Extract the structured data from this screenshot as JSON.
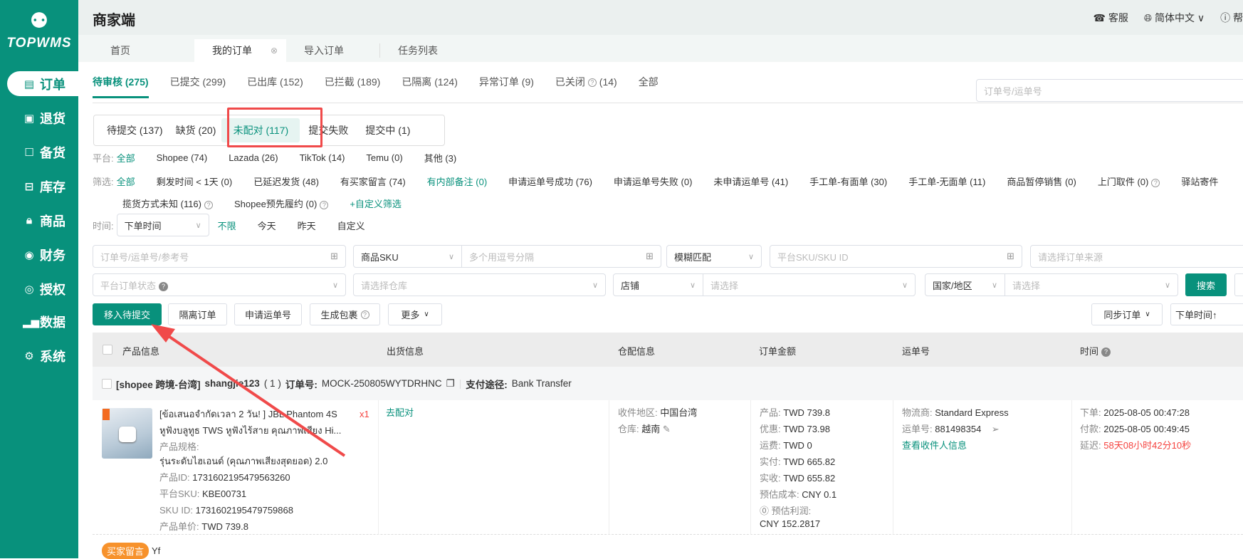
{
  "brand": {
    "name": "TOPWMS"
  },
  "sidebar": {
    "items": [
      {
        "label": "订单",
        "icon": "clipboard-icon",
        "active": true
      },
      {
        "label": "退货",
        "icon": "return-box-icon"
      },
      {
        "label": "备货",
        "icon": "bag-icon"
      },
      {
        "label": "库存",
        "icon": "inventory-icon"
      },
      {
        "label": "商品",
        "icon": "lock-bag-icon"
      },
      {
        "label": "财务",
        "icon": "finance-icon"
      },
      {
        "label": "授权",
        "icon": "alarm-icon"
      },
      {
        "label": "数据",
        "icon": "bar-chart-icon"
      },
      {
        "label": "系统",
        "icon": "gear-icon"
      }
    ]
  },
  "header": {
    "title": "商家端",
    "service": "客服",
    "language": "简体中文",
    "help": "帮"
  },
  "page_tabs": [
    {
      "label": "首页"
    },
    {
      "label": "我的订单",
      "active": true
    },
    {
      "label": "导入订单"
    },
    {
      "label": "任务列表"
    }
  ],
  "status_tabs": [
    {
      "label": "待审核 (275)",
      "active": true
    },
    {
      "label": "已提交 (299)"
    },
    {
      "label": "已出库 (152)"
    },
    {
      "label": "已拦截 (189)"
    },
    {
      "label": "已隔离 (124)"
    },
    {
      "label": "异常订单 (9)"
    },
    {
      "label": "已关闭",
      "count": "(14)"
    },
    {
      "label": "全部"
    }
  ],
  "top_search": {
    "placeholder": "订单号/运单号"
  },
  "sub_tabs": [
    {
      "label": "待提交 (137)"
    },
    {
      "label": "缺货 (20)"
    },
    {
      "label": "未配对 (117)",
      "active": true
    },
    {
      "label": "提交失败"
    },
    {
      "label": "提交中 (1)"
    }
  ],
  "platform": {
    "label": "平台:",
    "items": [
      "全部",
      "Shopee (74)",
      "Lazada (26)",
      "TikTok (14)",
      "Temu (0)",
      "其他 (3)"
    ]
  },
  "filters": {
    "label": "筛选:",
    "items": [
      "全部",
      "剩发时间 < 1天 (0)",
      "已延迟发货 (48)",
      "有买家留言 (74)",
      "有内部备注 (0)",
      "申请运单号成功 (76)",
      "申请运单号失败 (0)",
      "未申请运单号 (41)",
      "手工单-有面单 (30)",
      "手工单-无面单 (11)",
      "商品暂停销售 (0)",
      "上门取件 (0)",
      "驿站寄件"
    ],
    "line2": [
      "揽货方式未知 (116)",
      "Shopee预先履约 (0)"
    ],
    "custom": "+自定义筛选"
  },
  "time": {
    "label": "时间:",
    "select": "下单时间",
    "options": [
      "不限",
      "今天",
      "昨天",
      "自定义"
    ]
  },
  "search_form": {
    "order_no": "订单号/运单号/参考号",
    "sku_type": "商品SKU",
    "sku_ph": "多个用逗号分隔",
    "match": "模糊匹配",
    "platform_sku": "平台SKU/SKU ID",
    "source": "请选择订单来源",
    "platform_status": "平台订单状态",
    "warehouse": "请选择仓库",
    "shop": "店铺",
    "shop_ph": "请选择",
    "country": "国家/地区",
    "country_ph": "请选择",
    "search_btn": "搜索"
  },
  "actions": {
    "move": "移入待提交",
    "isolate": "隔离订单",
    "apply": "申请运单号",
    "package": "生成包裹",
    "more": "更多",
    "sync": "同步订单",
    "sort": "下单时间↑"
  },
  "table": {
    "columns": [
      "产品信息",
      "出货信息",
      "仓配信息",
      "订单金额",
      "运单号",
      "时间"
    ]
  },
  "order": {
    "shop": "[shopee 跨境-台湾]",
    "user": "shangjie123",
    "qty": "( 1 )",
    "order_no_label": "订单号:",
    "order_no": "MOCK-250805WYTDRHNC",
    "pay_label": "支付途径:",
    "pay": "Bank Transfer",
    "product": {
      "title1": "[ข้อเสนอจำกัดเวลา 2 วัน! ] JBL Phantom 4S",
      "title2": "หูฟังบลูทูธ TWS หูฟังไร้สาย คุณภาพเสียง Hi...",
      "qty": "x1",
      "spec_label": "产品规格:",
      "spec": "รุ่นระดับไฮเอนด์ (คุณภาพเสียงสุดยอด) 2.0",
      "id_label": "产品ID:",
      "id": "1731602195479563260",
      "psku_label": "平台SKU:",
      "psku": "KBE00731",
      "skuid_label": "SKU ID:",
      "skuid": "1731602195479759868",
      "price_label": "产品单价:",
      "price": "TWD 739.8"
    },
    "ship_action": "去配对",
    "warehouse": {
      "region_label": "收件地区:",
      "region": "中国台湾",
      "wh_label": "仓库:",
      "wh": "越南"
    },
    "amount": [
      {
        "k": "产品:",
        "v": "TWD 739.8"
      },
      {
        "k": "优惠:",
        "v": "TWD 73.98"
      },
      {
        "k": "运费:",
        "v": "TWD 0"
      },
      {
        "k": "实付:",
        "v": "TWD 665.82"
      },
      {
        "k": "实收:",
        "v": "TWD 655.82"
      },
      {
        "k": "预估成本:",
        "v": "CNY 0.1"
      }
    ],
    "profit_label": "预估利润:",
    "profit": "CNY 152.2817",
    "waybill": {
      "carrier_label": "物流商:",
      "carrier": "Standard Express",
      "no_label": "运单号:",
      "no": "881498354",
      "link": "查看收件人信息"
    },
    "time": {
      "order_label": "下单:",
      "order": "2025-08-05 00:47:28",
      "pay_label": "付款:",
      "pay": "2025-08-05 00:49:45",
      "delay_label": "延迟:",
      "delay": "58天08小时42分10秒"
    },
    "buyer_tag": "买家留言",
    "buyer_msg": "Yf"
  },
  "colors": {
    "primary": "#08917c",
    "highlight": "#f04a4a",
    "delay": "#f5433f",
    "tag": "#f7922c"
  }
}
